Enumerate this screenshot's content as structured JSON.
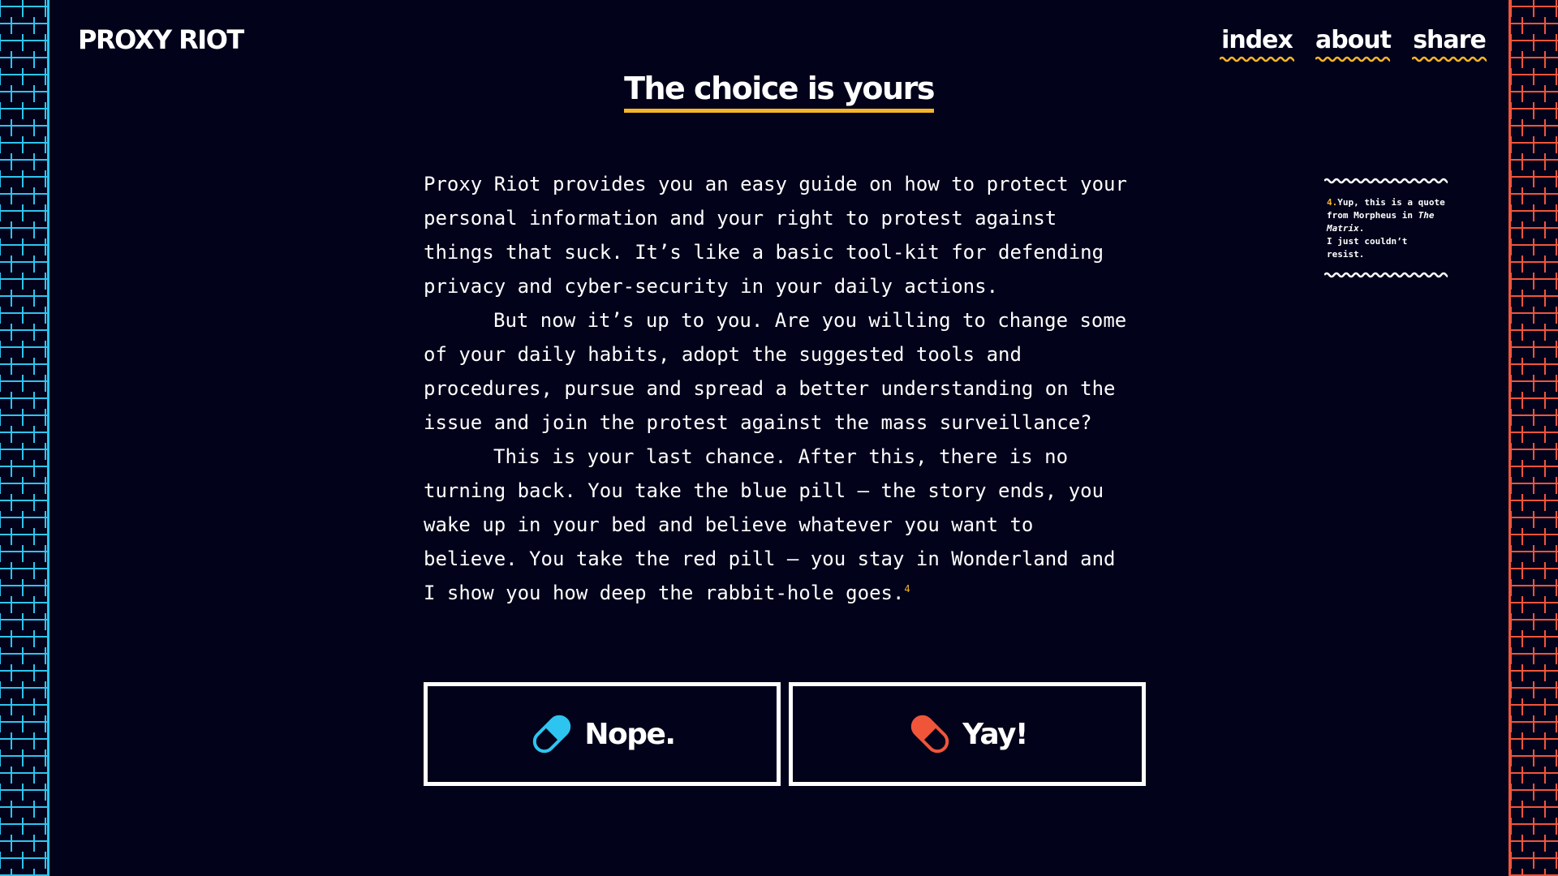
{
  "header": {
    "logo": "PROXY RIOT",
    "nav": [
      {
        "label": "index"
      },
      {
        "label": "about"
      },
      {
        "label": "share"
      }
    ]
  },
  "main": {
    "title": "The choice is yours",
    "paragraphs": [
      "Proxy Riot provides you an easy guide on how to protect your personal information and your right to protest against things that suck. It’s like a basic tool-kit for defending privacy and cyber-security in your daily actions.",
      "But now it’s up to you. Are you willing to change some of your daily habits, adopt the suggested tools and procedures, pursue and spread a better understanding on the issue and join the protest against the mass surveillance?",
      "This is your last chance. After this, there is no turning back. You take the blue pill — the story ends, you wake up in your bed and believe whatever you want to believe. You take the red pill — you stay in Wonderland and I show you how deep the rabbit-hole goes."
    ],
    "footnote_ref": "4"
  },
  "sidenote": {
    "number": "4.",
    "text_before": "Yup, this is a quote from Morpheus in ",
    "italic": "The Matrix",
    "text_after": ".",
    "line2": "I just couldn’t resist."
  },
  "buttons": {
    "nope": {
      "label": "Nope.",
      "icon": "blue-pill-icon",
      "color": "#2ec4f0"
    },
    "yay": {
      "label": "Yay!",
      "icon": "red-pill-icon",
      "color": "#f0553a"
    }
  },
  "colors": {
    "background": "#02021a",
    "accent": "#f4b52a",
    "left_wall": "#2ec4f0",
    "right_wall": "#f0553a"
  }
}
